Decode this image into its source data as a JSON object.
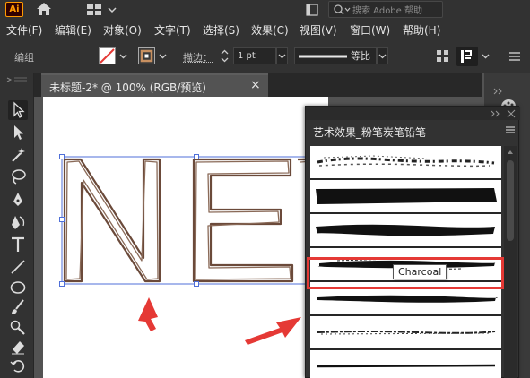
{
  "app": {
    "logo_text": "Ai"
  },
  "titlebar": {
    "search_placeholder": "搜索 Adobe 帮助"
  },
  "menu": {
    "items": [
      "文件(F)",
      "编辑(E)",
      "对象(O)",
      "文字(T)",
      "选择(S)",
      "效果(C)",
      "视图(V)",
      "窗口(W)",
      "帮助(H)"
    ]
  },
  "controls": {
    "selection_label": "编组",
    "stroke_label": "描边：",
    "stroke_weight": "1 pt",
    "profile_label": "等比"
  },
  "document_tab": {
    "title": "未标题-2* @ 100% (RGB/预览)",
    "close_glyph": "×"
  },
  "artwork": {
    "text": "NEV"
  },
  "brush_panel": {
    "title": "艺术效果_粉笔炭笔铅笔",
    "selected_index": 5,
    "tooltip": "Charcoal"
  },
  "colors": {
    "annotation_red": "#e53935",
    "ai_orange": "#ff9a00",
    "letter_stroke": "#6b4a3a",
    "selection_blue": "#4f6fd8"
  },
  "icons": [
    "home-icon",
    "workspace-grid-icon",
    "document-icon",
    "search-icon",
    "none-fill-icon",
    "stroke-swatch-icon",
    "chevron-down-icon",
    "panel-menu-icon",
    "close-icon"
  ]
}
